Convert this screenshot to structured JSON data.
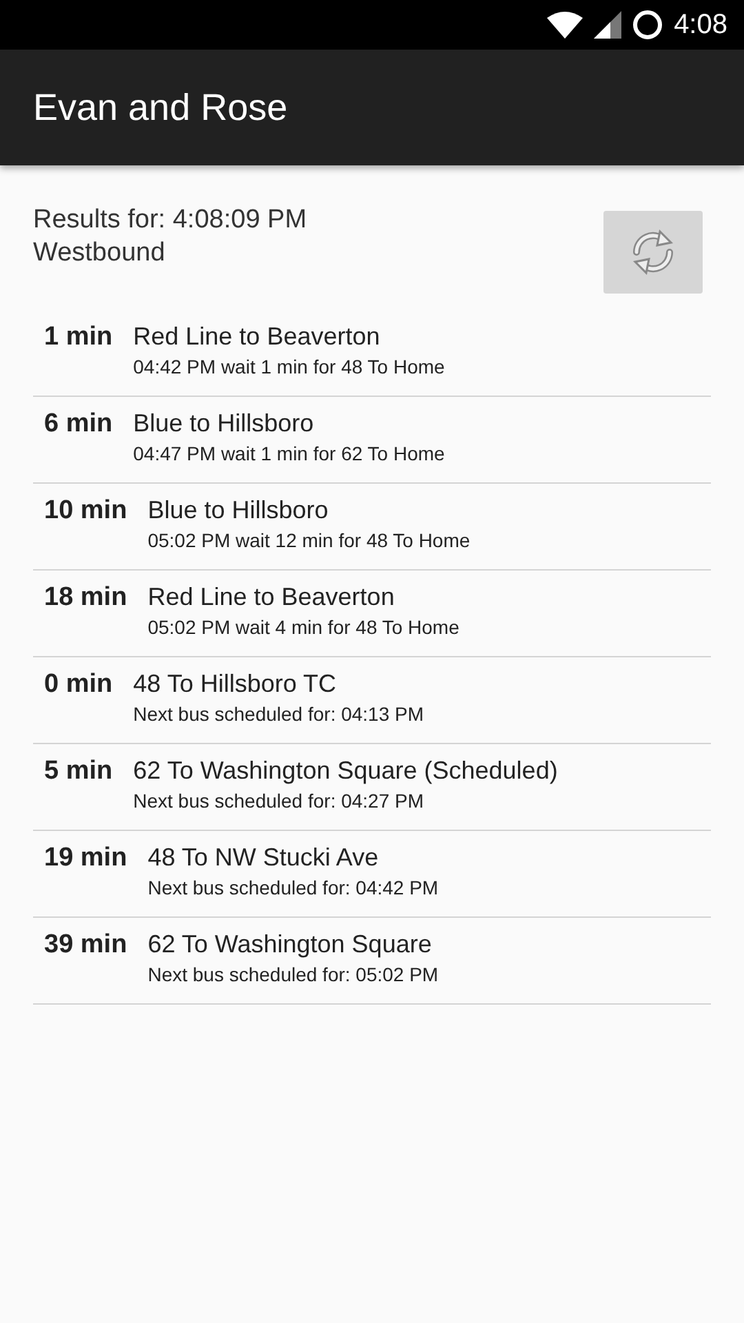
{
  "status_bar": {
    "time": "4:08"
  },
  "app_bar": {
    "title": "Evan and Rose"
  },
  "results": {
    "label": "Results for: 4:08:09 PM",
    "direction": "Westbound"
  },
  "arrivals": [
    {
      "eta": "1 min",
      "title": "Red Line to Beaverton",
      "detail": "04:42 PM wait 1 min for 48 To Home"
    },
    {
      "eta": "6 min",
      "title": "Blue to Hillsboro",
      "detail": "04:47 PM wait 1 min for 62 To Home"
    },
    {
      "eta": "10 min",
      "title": "Blue to Hillsboro",
      "detail": "05:02 PM wait 12 min for 48 To Home"
    },
    {
      "eta": "18 min",
      "title": "Red Line to Beaverton",
      "detail": "05:02 PM wait 4 min for 48 To Home"
    },
    {
      "eta": "0 min",
      "title": "48 To Hillsboro TC",
      "detail": "Next bus scheduled for: 04:13 PM"
    },
    {
      "eta": "5 min",
      "title": "62 To Washington Square (Scheduled)",
      "detail": "Next bus scheduled for: 04:27 PM"
    },
    {
      "eta": "19 min",
      "title": "48 To NW Stucki Ave",
      "detail": "Next bus scheduled for: 04:42 PM"
    },
    {
      "eta": "39 min",
      "title": "62 To Washington Square",
      "detail": "Next bus scheduled for: 05:02 PM"
    }
  ]
}
